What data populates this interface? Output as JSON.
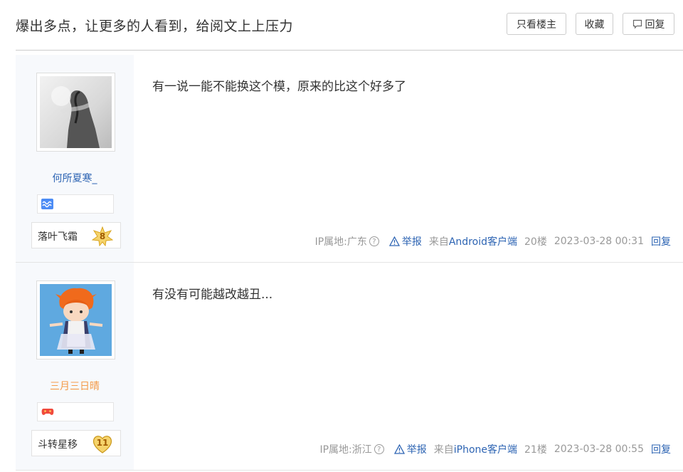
{
  "header": {
    "title": "爆出多点，让更多的人看到，给阅文上上压力",
    "only_op_label": "只看楼主",
    "favorite_label": "收藏",
    "reply_label": "回复",
    "reply_icon": "comment-icon"
  },
  "posts": [
    {
      "username": "何所夏寒_",
      "username_color": "#2d64b3",
      "badge_icon": "wave-badge-icon",
      "level_name": "落叶飞霜",
      "level": "8",
      "content": "有一说一能不能换这个模，原来的比这个好多了",
      "ip": "IP属地:广东",
      "help": "?",
      "report_label": "举报",
      "source_prefix": "来自",
      "source_client": "Android客户端",
      "floor": "20楼",
      "time": "2023-03-28 00:31",
      "reply_label": "回复"
    },
    {
      "username": "三月三日晴",
      "username_color": "#f49b48",
      "badge_icon": "game-badge-icon",
      "level_name": "斗转星移",
      "level": "11",
      "content": "有没有可能越改越丑...",
      "ip": "IP属地:浙江",
      "help": "?",
      "report_label": "举报",
      "source_prefix": "来自",
      "source_client": "iPhone客户端",
      "floor": "21楼",
      "time": "2023-03-28 00:55",
      "reply_label": "回复"
    }
  ],
  "colors": {
    "link": "#2d64b3",
    "meta": "#999999",
    "sidebar_bg": "#f7f9fc"
  }
}
